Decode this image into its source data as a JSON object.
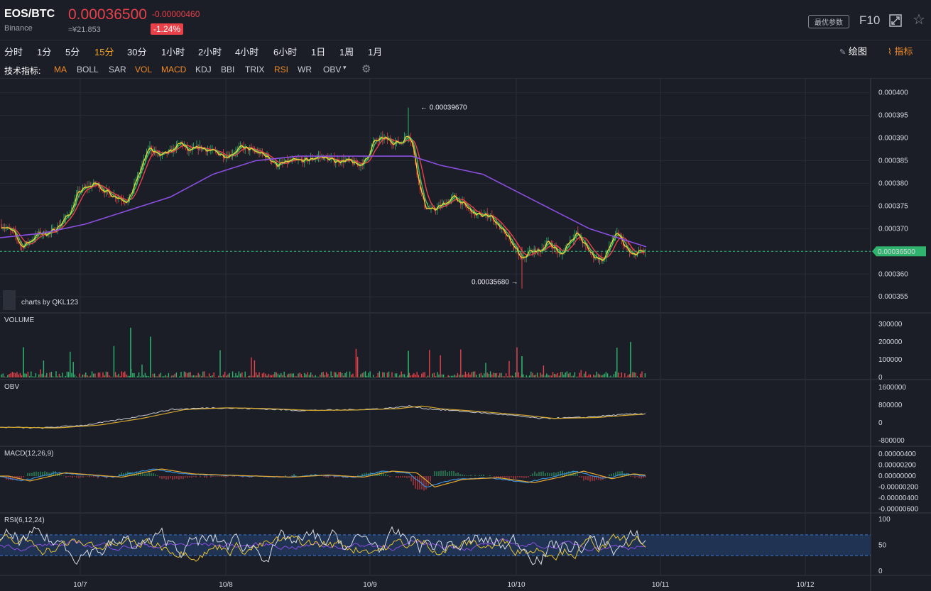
{
  "header": {
    "pair": "EOS/BTC",
    "exchange": "Binance",
    "price": "0.00036500",
    "price_cny": "≈¥21.853",
    "change": "-0.00000460",
    "change_pct": "-1.24%",
    "params_label": "最优参数",
    "f10_label": "F10"
  },
  "toolbar": {
    "timeframes": [
      "分时",
      "1分",
      "5分",
      "15分",
      "30分",
      "1小时",
      "2小时",
      "4小时",
      "6小时",
      "1日",
      "1周",
      "1月"
    ],
    "active_timeframe": "15分",
    "draw_label": "绘图",
    "indicator_label": "指标"
  },
  "indicator_bar": {
    "label": "技术指标:",
    "items": [
      "MA",
      "BOLL",
      "SAR",
      "VOL",
      "MACD",
      "KDJ",
      "BBI",
      "TRIX",
      "RSI",
      "WR",
      "OBV"
    ],
    "active": [
      "MA",
      "VOL",
      "MACD",
      "RSI"
    ]
  },
  "watermark": "charts by QKL123",
  "colors": {
    "up": "#2fb36d",
    "down": "#e9414a",
    "ma5": "#f5d130",
    "ma10": "#3fbf63",
    "ma20": "#e9414a",
    "ma60": "#8a4fe0",
    "accent": "#f08a24",
    "last_price": "#2fb36d"
  },
  "chart_data": [
    {
      "type": "candlestick",
      "series": [
        {
          "name": "EOS/BTC 15m"
        }
      ],
      "x_ticks": [
        "10/7",
        "10/8",
        "10/9",
        "10/10",
        "10/11",
        "10/12"
      ],
      "y_ticks": [
        "0.000400",
        "0.000395",
        "0.000390",
        "0.000385",
        "0.000380",
        "0.000375",
        "0.000370",
        "0.000365",
        "0.000360",
        "0.000355"
      ],
      "ylim": [
        0.000353,
        0.0004015
      ],
      "annotations": {
        "high": "0.00039670",
        "low": "0.00035680",
        "last": "0.00036500"
      },
      "close_path": [
        [
          0,
          0.000371
        ],
        [
          10,
          0.00037
        ],
        [
          20,
          0.000369
        ],
        [
          30,
          0.000366
        ],
        [
          40,
          0.000367
        ],
        [
          55,
          0.000369
        ],
        [
          70,
          0.000369
        ],
        [
          85,
          0.000371
        ],
        [
          100,
          0.000374
        ],
        [
          110,
          0.000378
        ],
        [
          120,
          0.000379
        ],
        [
          135,
          0.00038
        ],
        [
          150,
          0.000378
        ],
        [
          165,
          0.000377
        ],
        [
          180,
          0.000376
        ],
        [
          190,
          0.00038
        ],
        [
          200,
          0.000384
        ],
        [
          210,
          0.000388
        ],
        [
          225,
          0.000386
        ],
        [
          240,
          0.000387
        ],
        [
          255,
          0.000389
        ],
        [
          265,
          0.000387
        ],
        [
          280,
          0.000388
        ],
        [
          300,
          0.000387
        ],
        [
          320,
          0.000386
        ],
        [
          340,
          0.000388
        ],
        [
          360,
          0.000387
        ],
        [
          375,
          0.000386
        ],
        [
          390,
          0.000384
        ],
        [
          410,
          0.000385
        ],
        [
          430,
          0.000385
        ],
        [
          450,
          0.000386
        ],
        [
          470,
          0.000385
        ],
        [
          490,
          0.000385
        ],
        [
          505,
          0.000384
        ],
        [
          515,
          0.000385
        ],
        [
          525,
          0.000389
        ],
        [
          540,
          0.00039
        ],
        [
          555,
          0.000389
        ],
        [
          565,
          0.000389
        ],
        [
          575,
          0.000391
        ],
        [
          580,
          0.000389
        ],
        [
          590,
          0.00038
        ],
        [
          598,
          0.000375
        ],
        [
          608,
          0.000374
        ],
        [
          620,
          0.000375
        ],
        [
          640,
          0.000377
        ],
        [
          655,
          0.000375
        ],
        [
          670,
          0.000373
        ],
        [
          690,
          0.000373
        ],
        [
          705,
          0.00037
        ],
        [
          720,
          0.000367
        ],
        [
          735,
          0.000363
        ],
        [
          745,
          0.000365
        ],
        [
          760,
          0.000365
        ],
        [
          770,
          0.000367
        ],
        [
          780,
          0.000366
        ],
        [
          790,
          0.000364
        ],
        [
          800,
          0.000367
        ],
        [
          812,
          0.000369
        ],
        [
          825,
          0.000366
        ],
        [
          835,
          0.000364
        ],
        [
          850,
          0.000363
        ],
        [
          860,
          0.000367
        ],
        [
          870,
          0.000369
        ],
        [
          880,
          0.000366
        ],
        [
          890,
          0.000364
        ],
        [
          900,
          0.000365
        ],
        [
          910,
          0.000365
        ]
      ],
      "ma60_path": [
        [
          0,
          0.000368
        ],
        [
          60,
          0.000369
        ],
        [
          120,
          0.000371
        ],
        [
          180,
          0.000374
        ],
        [
          240,
          0.000377
        ],
        [
          300,
          0.000382
        ],
        [
          360,
          0.000385
        ],
        [
          420,
          0.000386
        ],
        [
          480,
          0.000386
        ],
        [
          540,
          0.000386
        ],
        [
          580,
          0.000386
        ],
        [
          620,
          0.000384
        ],
        [
          680,
          0.000382
        ],
        [
          730,
          0.000378
        ],
        [
          780,
          0.000374
        ],
        [
          830,
          0.00037
        ],
        [
          870,
          0.000368
        ],
        [
          910,
          0.000366
        ]
      ]
    },
    {
      "type": "bar",
      "title": "VOLUME",
      "y_ticks": [
        "300000",
        "200000",
        "100000",
        "0"
      ],
      "ylim": [
        0,
        300000
      ]
    },
    {
      "type": "line",
      "title": "OBV",
      "y_ticks": [
        "1600000",
        "800000",
        "0",
        "-800000"
      ],
      "ylim": [
        -800000,
        1600000
      ],
      "series_path": [
        [
          0,
          -200000
        ],
        [
          60,
          -230000
        ],
        [
          120,
          -100000
        ],
        [
          180,
          200000
        ],
        [
          240,
          600000
        ],
        [
          300,
          680000
        ],
        [
          360,
          640000
        ],
        [
          420,
          560000
        ],
        [
          480,
          580000
        ],
        [
          540,
          640000
        ],
        [
          575,
          760000
        ],
        [
          600,
          640000
        ],
        [
          660,
          500000
        ],
        [
          720,
          340000
        ],
        [
          760,
          200000
        ],
        [
          820,
          240000
        ],
        [
          870,
          360000
        ],
        [
          910,
          420000
        ]
      ]
    },
    {
      "type": "line",
      "title": "MACD(12,26,9)",
      "y_ticks": [
        "0.00000400",
        "0.00000200",
        "0.00000000",
        "-0.00000200",
        "-0.00000400",
        "-0.00000600"
      ],
      "ylim": [
        -6e-07,
        4e-07
      ],
      "series_path": [
        [
          0,
          0
        ],
        [
          30,
          -9e-07
        ],
        [
          80,
          6e-07
        ],
        [
          120,
          2e-07
        ],
        [
          160,
          -2e-07
        ],
        [
          215,
          1.3e-06
        ],
        [
          260,
          4e-07
        ],
        [
          300,
          2e-07
        ],
        [
          350,
          0
        ],
        [
          400,
          -2e-07
        ],
        [
          450,
          2e-07
        ],
        [
          500,
          -2e-07
        ],
        [
          540,
          9e-07
        ],
        [
          575,
          6e-07
        ],
        [
          600,
          -2e-06
        ],
        [
          640,
          -6e-07
        ],
        [
          690,
          -3e-07
        ],
        [
          740,
          -1.2e-06
        ],
        [
          780,
          -1e-07
        ],
        [
          810,
          9e-07
        ],
        [
          850,
          -5e-07
        ],
        [
          880,
          4e-07
        ],
        [
          910,
          0
        ]
      ]
    },
    {
      "type": "line",
      "title": "RSI(6,12,24)",
      "y_ticks": [
        "100",
        "50",
        "0"
      ],
      "ylim": [
        0,
        100
      ],
      "bands": [
        70,
        30
      ]
    }
  ]
}
